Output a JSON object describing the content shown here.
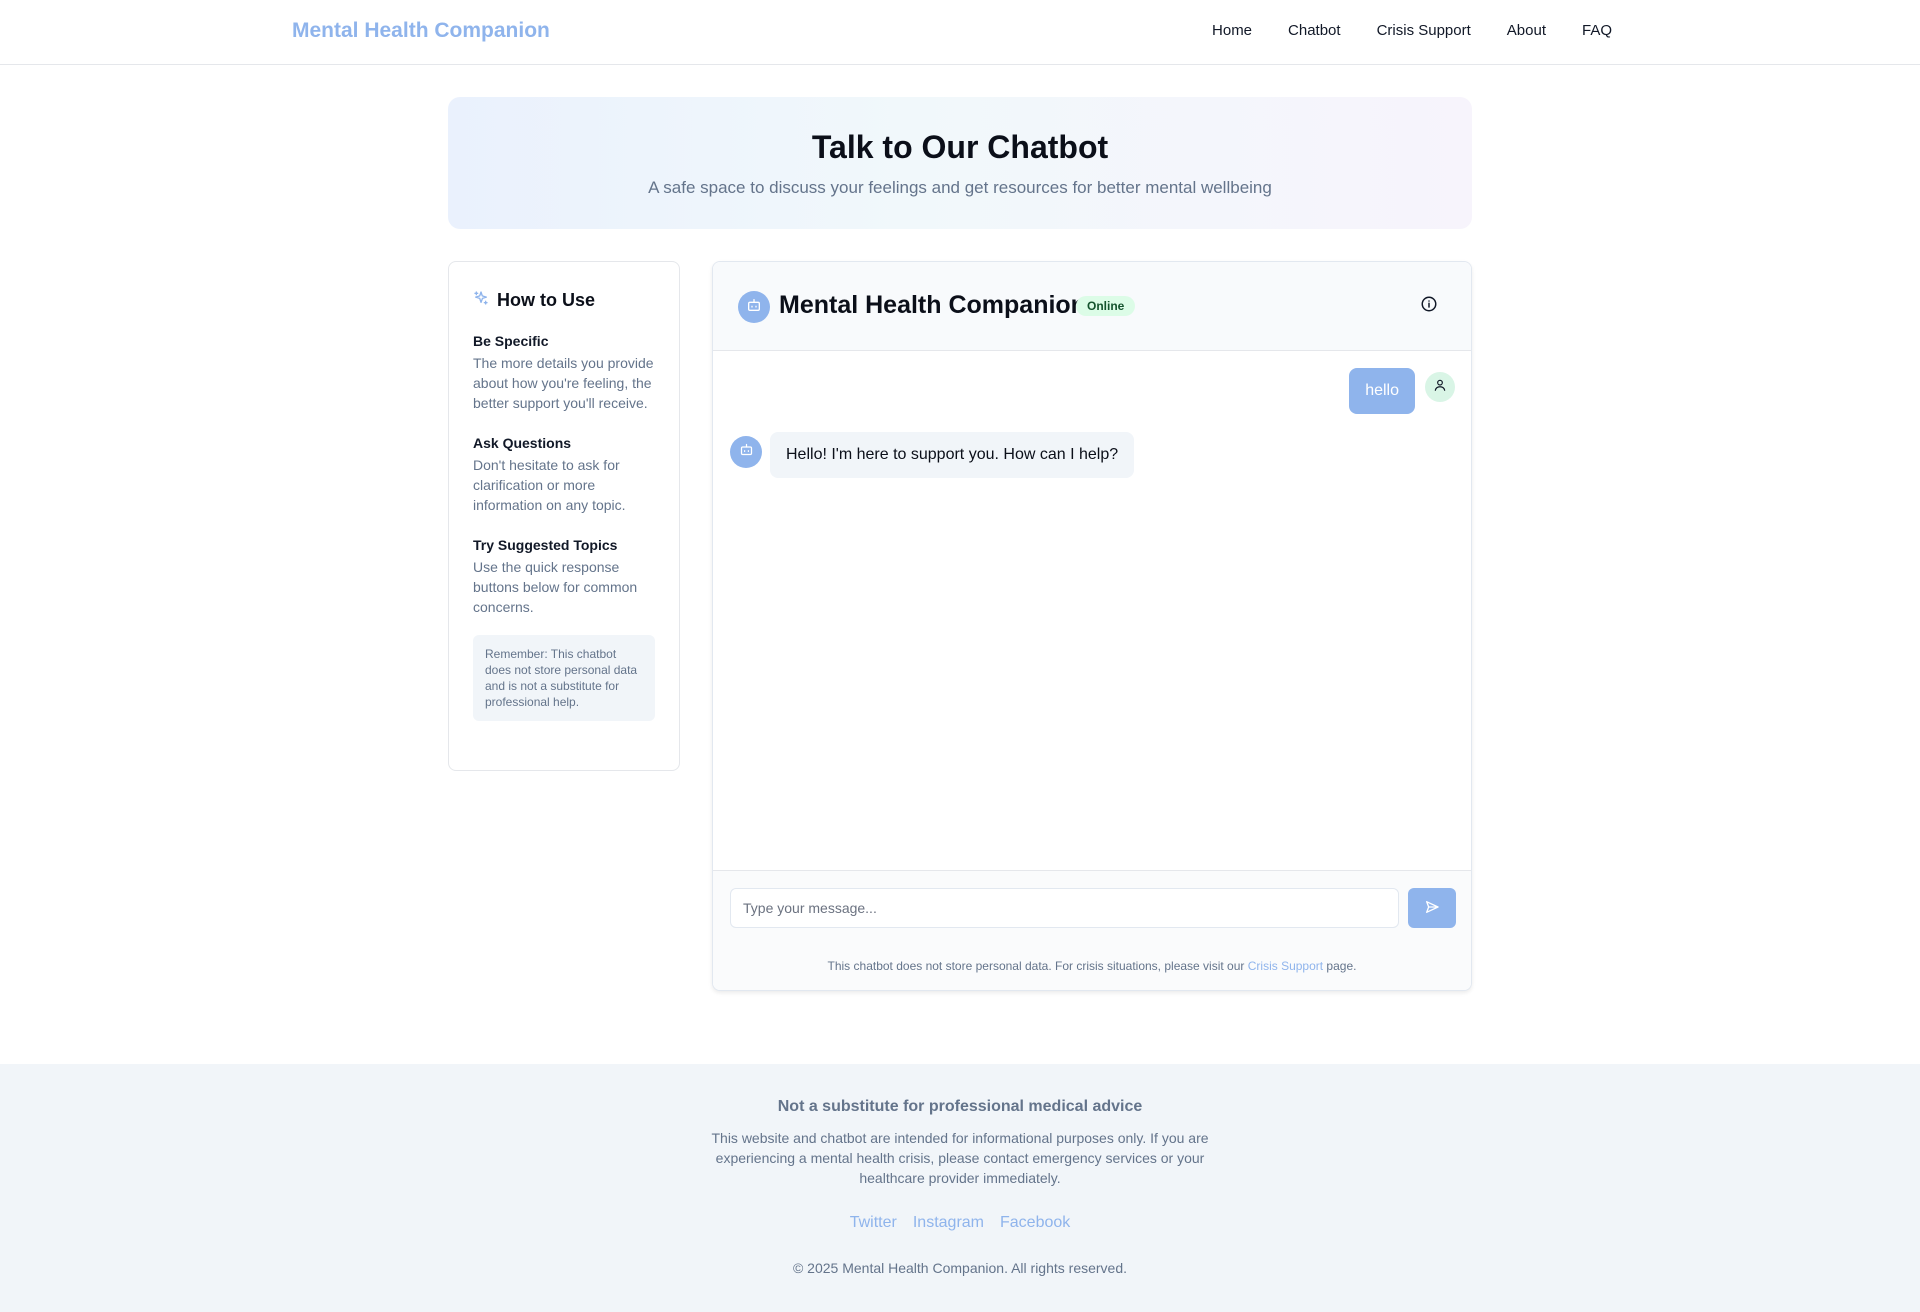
{
  "header": {
    "brand": "Mental Health Companion",
    "nav": [
      "Home",
      "Chatbot",
      "Crisis Support",
      "About",
      "FAQ"
    ]
  },
  "hero": {
    "title": "Talk to Our Chatbot",
    "subtitle": "A safe space to discuss your feelings and get resources for better mental wellbeing"
  },
  "sidebar": {
    "title": "How to Use",
    "sections": [
      {
        "heading": "Be Specific",
        "body": "The more details you provide about how you're feeling, the better support you'll receive."
      },
      {
        "heading": "Ask Questions",
        "body": "Don't hesitate to ask for clarification or more information on any topic."
      },
      {
        "heading": "Try Suggested Topics",
        "body": "Use the quick response buttons below for common concerns."
      }
    ],
    "note": "Remember: This chatbot does not store personal data and is not a substitute for professional help."
  },
  "chat": {
    "title": "Mental Health Companion",
    "status": "Online",
    "messages": [
      {
        "role": "user",
        "text": "hello"
      },
      {
        "role": "bot",
        "text": "Hello! I'm here to support you. How can I help?"
      }
    ],
    "input_placeholder": "Type your message...",
    "disclaimer_before": "This chatbot does not store personal data. For crisis situations, please visit our ",
    "disclaimer_link": "Crisis Support",
    "disclaimer_after": " page."
  },
  "footer": {
    "heading": "Not a substitute for professional medical advice",
    "description": "This website and chatbot are intended for informational purposes only. If you are experiencing a mental health crisis, please contact emergency services or your healthcare provider immediately.",
    "social": [
      "Twitter",
      "Instagram",
      "Facebook"
    ],
    "copyright": "© 2025 Mental Health Companion. All rights reserved."
  },
  "icons": {
    "sidebar": "sparkles-icon",
    "bot": "bot-icon",
    "user": "user-icon",
    "info": "info-icon",
    "send": "send-icon"
  },
  "colors": {
    "accent": "#8fb4ec",
    "status_bg": "#dcfce7",
    "user_avatar_bg": "#d9f5e6"
  }
}
